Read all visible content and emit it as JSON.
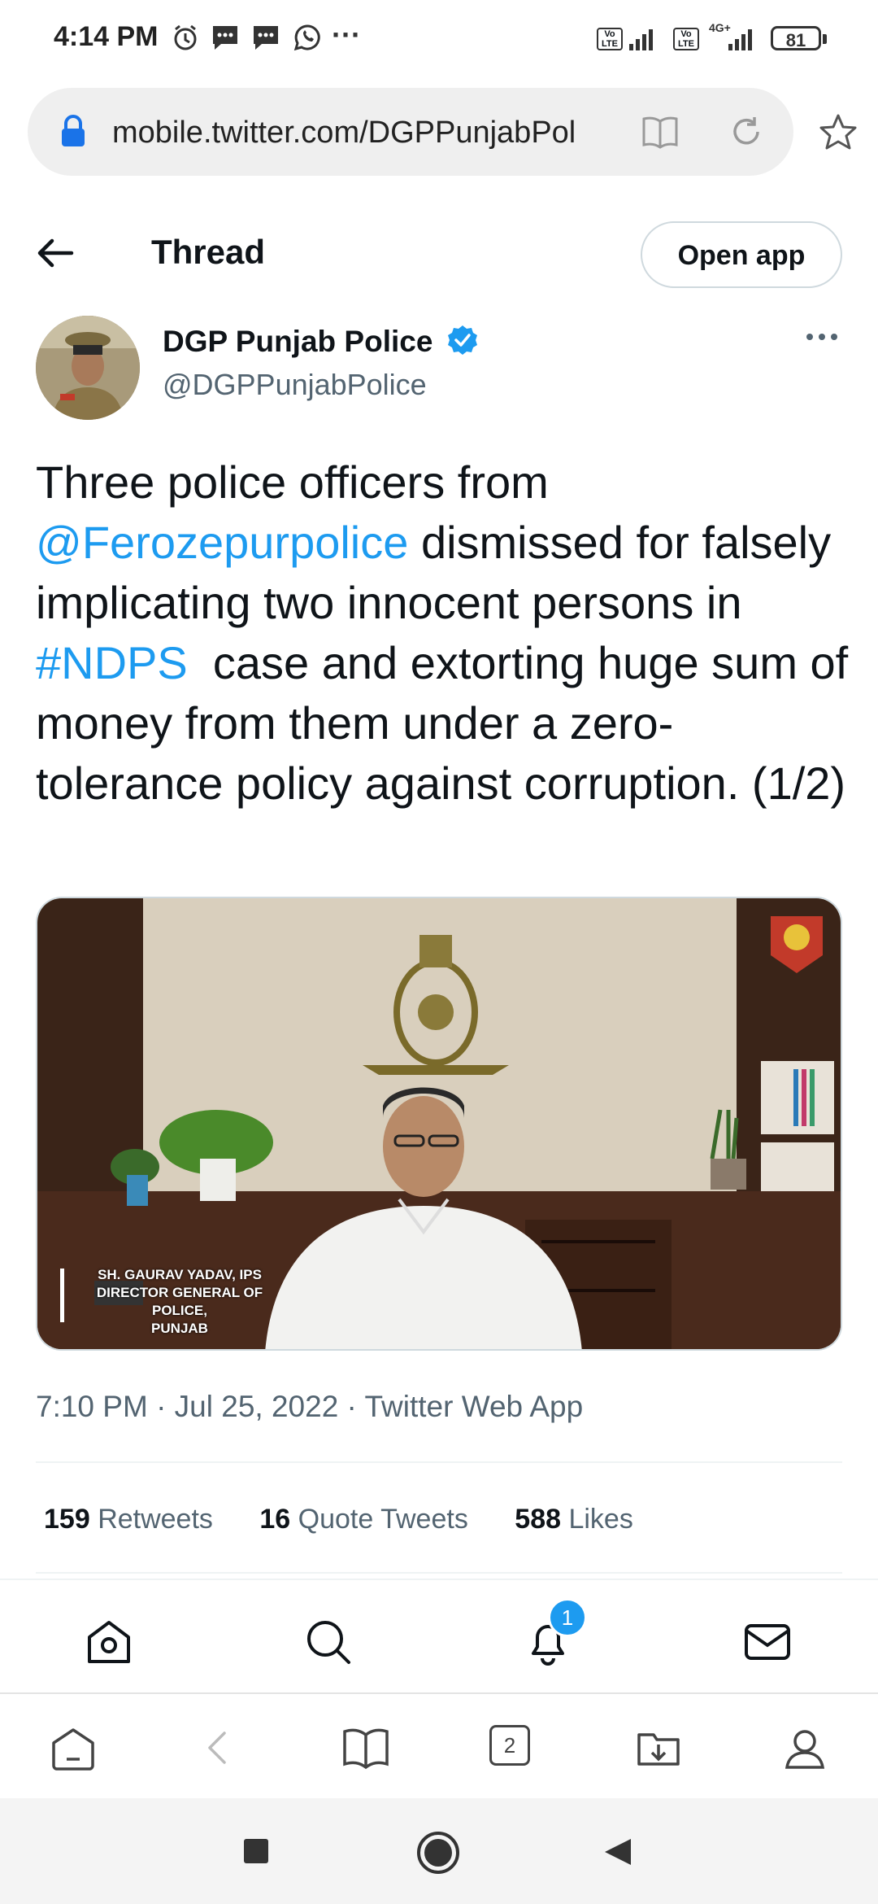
{
  "status_bar": {
    "time": "4:14 PM",
    "battery": "81",
    "network_labels": [
      "Vo LTE",
      "Vo LTE",
      "4G+"
    ]
  },
  "browser": {
    "url": "mobile.twitter.com/DGPPunjabPol",
    "tabs_count": "2"
  },
  "header": {
    "title": "Thread",
    "open_app_label": "Open app"
  },
  "tweet": {
    "author_name": "DGP Punjab Police",
    "author_handle": "@DGPPunjabPolice",
    "verified": true,
    "text_parts": {
      "p1": "Three police officers from ",
      "mention": "@Ferozepurpolice",
      "p2": " dismissed for falsely implicating two innocent persons in ",
      "hashtag": "#NDPS",
      "p3": "  case and extorting huge sum of money from them under a zero-tolerance policy against corruption. (1/2)"
    },
    "media_caption": {
      "line1": "SH. GAURAV YADAV, IPS",
      "line2": "DIRECTOR GENERAL OF POLICE,",
      "line3": "PUNJAB"
    },
    "meta": "7:10 PM · Jul 25, 2022 · Twitter Web App",
    "stats": {
      "retweets_count": "159",
      "retweets_label": "Retweets",
      "quotes_count": "16",
      "quotes_label": "Quote Tweets",
      "likes_count": "588",
      "likes_label": "Likes"
    }
  },
  "twitter_nav": {
    "items": [
      "home-icon",
      "search-icon",
      "notifications-icon",
      "messages-icon"
    ],
    "notifications_badge": "1"
  },
  "browser_toolbar": {
    "items": [
      "home-icon",
      "back-icon",
      "reader-icon",
      "tabs-icon",
      "downloads-icon",
      "profile-icon"
    ]
  },
  "colors": {
    "link": "#1d9bf0",
    "text": "#0f1419",
    "secondary": "#536471"
  }
}
